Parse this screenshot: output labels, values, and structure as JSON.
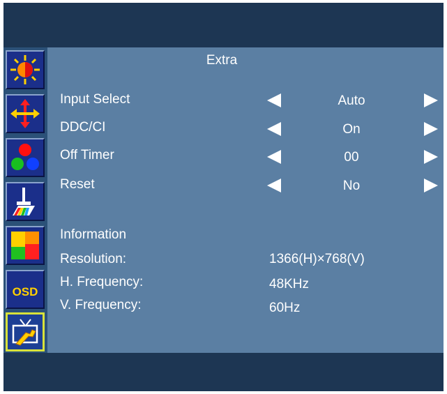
{
  "menu": {
    "title": "Extra",
    "icons": [
      {
        "name": "brightness-contrast-icon"
      },
      {
        "name": "position-icon"
      },
      {
        "name": "color-icon"
      },
      {
        "name": "picture-icon"
      },
      {
        "name": "input-icon"
      },
      {
        "name": "osd-icon",
        "text": "OSD"
      },
      {
        "name": "extra-icon"
      }
    ],
    "settings": [
      {
        "label": "Input Select",
        "value": "Auto"
      },
      {
        "label": "DDC/CI",
        "value": "On"
      },
      {
        "label": "Off Timer",
        "value": "00"
      },
      {
        "label": "Reset",
        "value": "No"
      }
    ],
    "info": {
      "heading": "Information",
      "rows": [
        {
          "label": "Resolution:",
          "value": "1366(H)×768(V)"
        },
        {
          "label": "H. Frequency:",
          "value": "48KHz"
        },
        {
          "label": "V. Frequency:",
          "value": "60Hz"
        }
      ]
    }
  },
  "colors": {
    "frame": "#1d3653",
    "panel": "#5b7fa3",
    "sidebar": "#2b5178",
    "tile": "#1b2f8a",
    "selected_border": "#d8e23a",
    "text": "#ffffff"
  }
}
